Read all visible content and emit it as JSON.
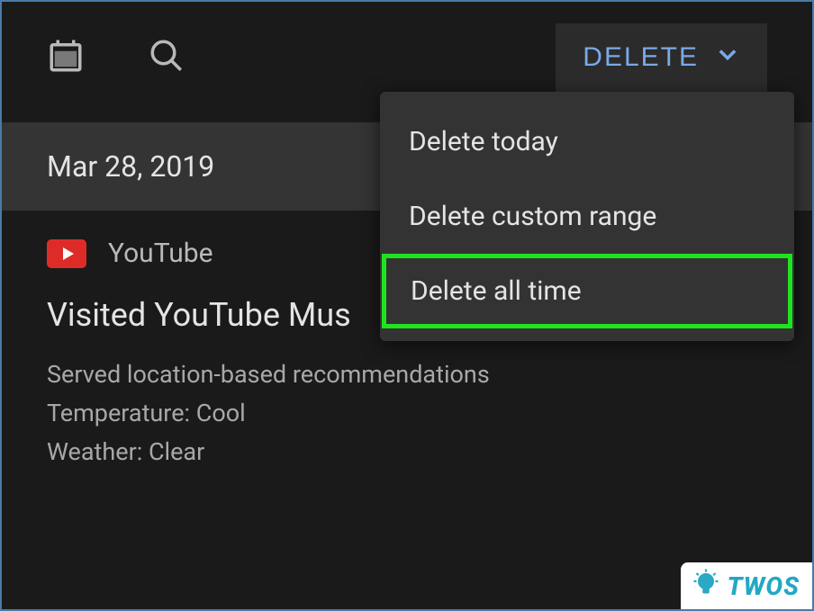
{
  "toolbar": {
    "delete_label": "DELETE"
  },
  "dropdown": {
    "items": [
      {
        "label": "Delete today"
      },
      {
        "label": "Delete custom range"
      },
      {
        "label": "Delete all time"
      }
    ]
  },
  "date_header": "Mar 28, 2019",
  "activity": {
    "source_label": "YouTube",
    "title": "Visited YouTube Mus",
    "details": {
      "recommendations": "Served location-based recommendations",
      "temperature": "Temperature: Cool",
      "weather": "Weather: Clear"
    }
  },
  "watermark": {
    "text": "TWOS"
  }
}
